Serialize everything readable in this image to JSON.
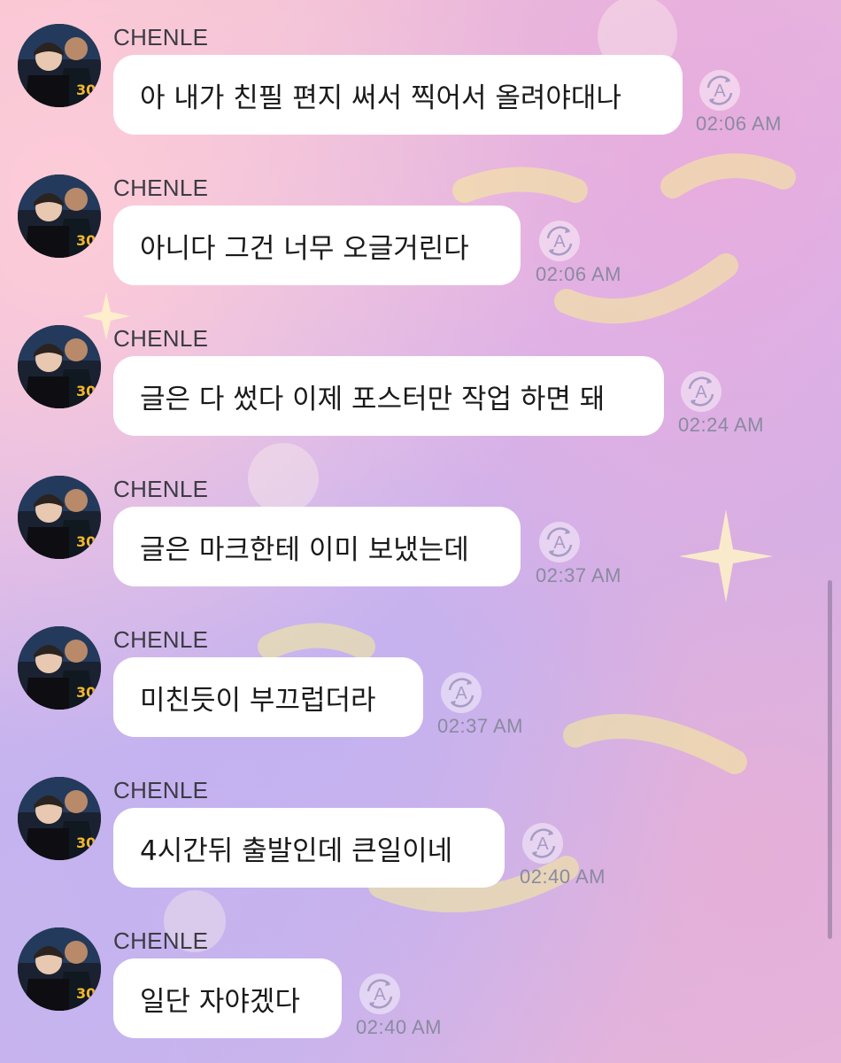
{
  "messages": [
    {
      "sender": "CHENLE",
      "text": "아 내가 친필 편지 써서 찍어서 올려야대나",
      "time": "02:06 AM"
    },
    {
      "sender": "CHENLE",
      "text": "아니다 그건 너무 오글거린다",
      "time": "02:06 AM"
    },
    {
      "sender": "CHENLE",
      "text": "글은 다 썼다 이제 포스터만 작업 하면 돼",
      "time": "02:24 AM"
    },
    {
      "sender": "CHENLE",
      "text": "글은 마크한테 이미 보냈는데",
      "time": "02:37 AM"
    },
    {
      "sender": "CHENLE",
      "text": "미친듯이 부끄럽더라",
      "time": "02:37 AM"
    },
    {
      "sender": "CHENLE",
      "text": "4시간뒤 출발인데 큰일이네",
      "time": "02:40 AM"
    },
    {
      "sender": "CHENLE",
      "text": "일단 자야겠다",
      "time": "02:40 AM"
    }
  ],
  "icons": {
    "avatar": "profile-photo",
    "translate": "auto-translate-icon"
  },
  "colors": {
    "bubble": "#ffffff",
    "text": "#1a1a1a",
    "sender": "#3c3c44",
    "time": "#8a8aa0",
    "icon": "#a89cc4"
  }
}
